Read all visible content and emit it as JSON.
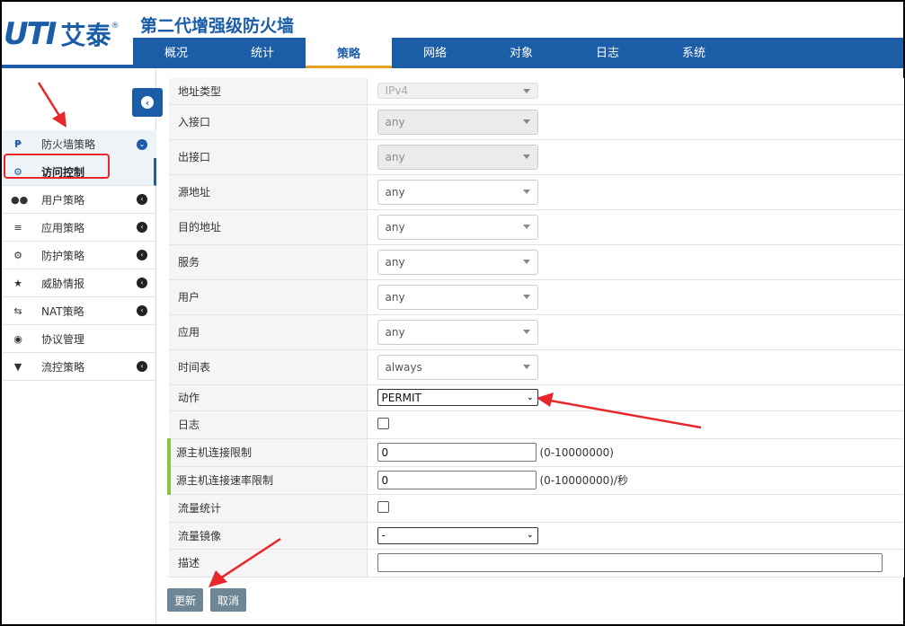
{
  "app": {
    "logo_latin": "UTI",
    "logo_cn": "艾泰",
    "logo_reg": "®",
    "title": "第二代增强级防火墙"
  },
  "nav": {
    "tabs": [
      {
        "label": "概况",
        "active": false
      },
      {
        "label": "统计",
        "active": false
      },
      {
        "label": "策略",
        "active": true
      },
      {
        "label": "网络",
        "active": false
      },
      {
        "label": "对象",
        "active": false
      },
      {
        "label": "日志",
        "active": false
      },
      {
        "label": "系统",
        "active": false
      }
    ]
  },
  "sidebar": {
    "items": [
      {
        "label": "防火墙策略",
        "icon": "firewall-icon",
        "expanded": true
      },
      {
        "label": "访问控制",
        "icon": "gear-icon",
        "active": true
      },
      {
        "label": "用户策略",
        "icon": "users-icon"
      },
      {
        "label": "应用策略",
        "icon": "layers-icon"
      },
      {
        "label": "防护策略",
        "icon": "gear-icon"
      },
      {
        "label": "威胁情报",
        "icon": "bug-icon"
      },
      {
        "label": "NAT策略",
        "icon": "swap-icon"
      },
      {
        "label": "协议管理",
        "icon": "globe-icon"
      },
      {
        "label": "流控策略",
        "icon": "filter-icon"
      }
    ]
  },
  "form": {
    "address_type": {
      "label": "地址类型",
      "value": "IPv4"
    },
    "in_interface": {
      "label": "入接口",
      "value": "any"
    },
    "out_interface": {
      "label": "出接口",
      "value": "any"
    },
    "source_address": {
      "label": "源地址",
      "value": "any"
    },
    "dest_address": {
      "label": "目的地址",
      "value": "any"
    },
    "service": {
      "label": "服务",
      "value": "any"
    },
    "user": {
      "label": "用户",
      "value": "any"
    },
    "application": {
      "label": "应用",
      "value": "any"
    },
    "schedule": {
      "label": "时间表",
      "value": "always"
    },
    "action": {
      "label": "动作",
      "value": "PERMIT"
    },
    "log": {
      "label": "日志",
      "checked": false
    },
    "src_conn_limit": {
      "label": "源主机连接限制",
      "value": "0",
      "hint": "(0-10000000)"
    },
    "src_rate_limit": {
      "label": "源主机连接速率限制",
      "value": "0",
      "hint": "(0-10000000)/秒"
    },
    "traffic_stats": {
      "label": "流量统计",
      "checked": false
    },
    "traffic_mirror": {
      "label": "流量镜像",
      "value": "-"
    },
    "description": {
      "label": "描述",
      "value": ""
    }
  },
  "buttons": {
    "update": "更新",
    "cancel": "取消"
  },
  "colors": {
    "brand": "#1c5da8",
    "annotation": "#e8262b",
    "accent_tab": "#e8a020"
  }
}
